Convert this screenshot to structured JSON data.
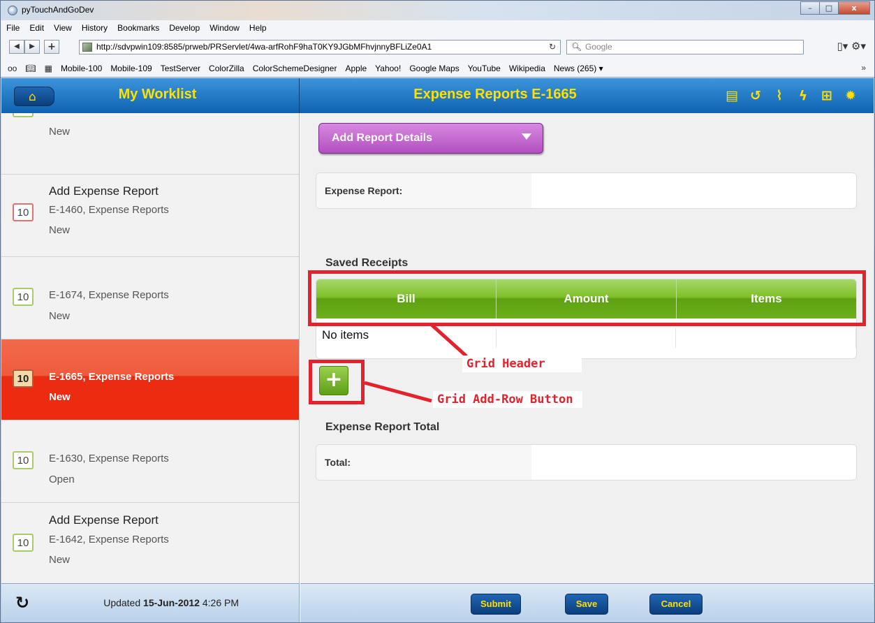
{
  "window": {
    "title": "pyTouchAndGoDev",
    "min": "–",
    "max": "□",
    "close": "x"
  },
  "menu": [
    "File",
    "Edit",
    "View",
    "History",
    "Bookmarks",
    "Develop",
    "Window",
    "Help"
  ],
  "toolbar": {
    "url": "http://sdvpwin109:8585/prweb/PRServlet/4wa-arfRohF9haT0KY9JGbMFhvjnnyBFLiZe0A1",
    "search_placeholder": "Google"
  },
  "bookmarks": [
    "Mobile-100",
    "Mobile-109",
    "TestServer",
    "ColorZilla",
    "ColorSchemeDesigner",
    "Apple",
    "Yahoo!",
    "Google Maps",
    "YouTube",
    "Wikipedia",
    "News (265) ▾"
  ],
  "left": {
    "title": "My Worklist",
    "items": [
      {
        "partial": true,
        "line3": "New"
      },
      {
        "badge": "10",
        "line1": "Add Expense Report",
        "line2": "E-1460, Expense Reports",
        "line3": "New",
        "color": "red"
      },
      {
        "badge": "10",
        "line1": "",
        "line2": "E-1674, Expense Reports",
        "line3": "New",
        "color": "green"
      },
      {
        "badge": "10",
        "line1": "",
        "line2": "E-1665, Expense Reports",
        "line3": "New",
        "color": "active"
      },
      {
        "badge": "10",
        "line1": "",
        "line2": "E-1630, Expense Reports",
        "line3": "Open",
        "color": "green"
      },
      {
        "badge": "10",
        "line1": "Add Expense Report",
        "line2": "E-1642, Expense Reports",
        "line3": "New",
        "color": "green"
      }
    ],
    "footer": {
      "updated_prefix": "Updated ",
      "updated_date": "15-Jun-2012",
      "updated_time": " 4:26 PM"
    }
  },
  "main": {
    "title": "Expense Reports E-1665",
    "dropdown_label": "Add Report Details",
    "expense_report_label": "Expense Report:",
    "saved_receipts_title": "Saved Receipts",
    "grid_columns": [
      "Bill",
      "Amount",
      "Items"
    ],
    "grid_empty": "No items",
    "total_section_title": "Expense Report Total",
    "total_label": "Total:",
    "buttons": {
      "submit": "Submit",
      "save": "Save",
      "cancel": "Cancel"
    }
  },
  "annotations": {
    "grid_header": "Grid Header",
    "add_row": "Grid Add-Row Button"
  },
  "colors": {
    "header_blue": "#0e62b0",
    "header_text": "#ffe000",
    "active_item": "#ea2c12",
    "grid_green": "#7fbf29",
    "dropdown_purple": "#b24fc0",
    "annotation_red": "#e2222c"
  }
}
